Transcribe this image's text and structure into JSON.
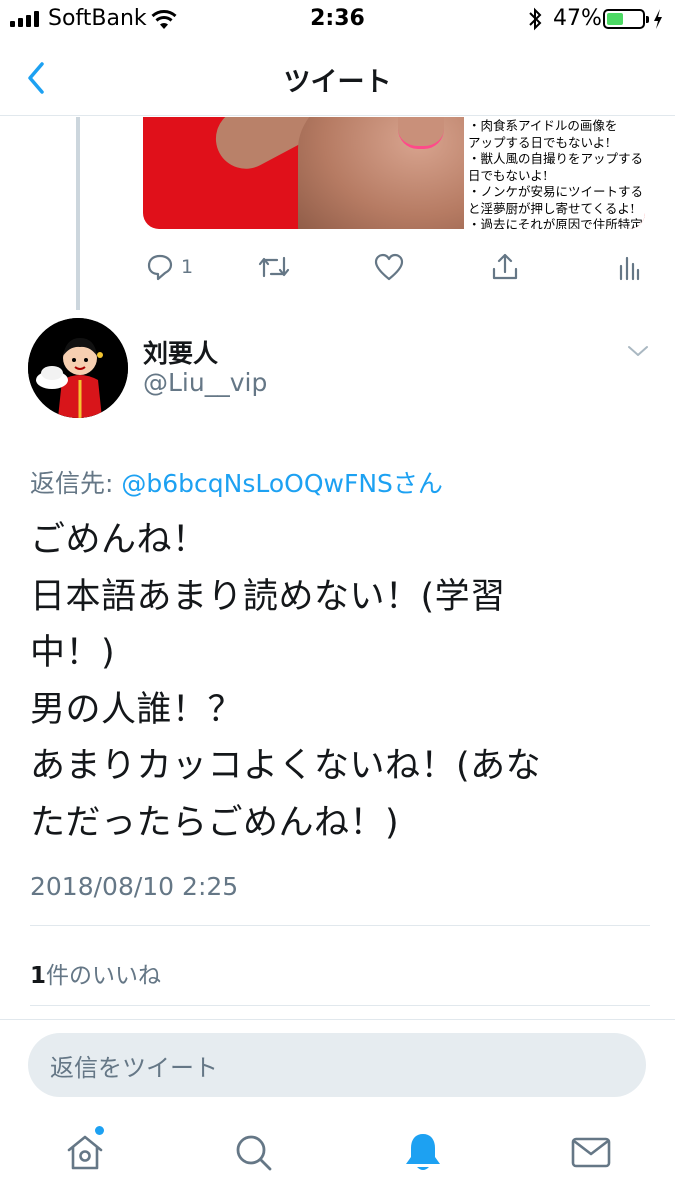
{
  "status_bar": {
    "carrier": "SoftBank",
    "time": "2:36",
    "battery_percent": "47%",
    "battery_level": 0.47,
    "icons": [
      "signal-icon",
      "wifi-icon",
      "bluetooth-icon",
      "battery-icon",
      "charging-icon"
    ]
  },
  "nav": {
    "title": "ツイート",
    "back_icon": "chevron-left-icon"
  },
  "parent_tweet": {
    "media_caption_lines": [
      "・肉食系アイドルの画像を",
      "アップする日でもないよ!",
      "・獣人風の自撮りをアップする",
      "日でもないよ!",
      "・ノンケが安易にツイートする",
      "と淫夢厨が押し寄せてくるよ!",
      "・過去にそれが原因で住所特定"
    ],
    "reply_count": "1",
    "actions": [
      "reply-icon",
      "retweet-icon",
      "like-icon",
      "share-icon",
      "analytics-icon"
    ]
  },
  "tweet": {
    "author_name": "刘要人",
    "author_handle": "@Liu__vip",
    "reply_to_label": "返信先: ",
    "reply_to_handle": "@b6bcqNsLoOQwFNSさん",
    "text_lines": [
      "ごめんね！",
      "日本語あまり読めない！(学習",
      "中！)",
      "男の人誰！？",
      "あまりカッコよくないね！(あな",
      "ただったらごめんね！)"
    ],
    "timestamp": "2018/08/10 2:25",
    "likes_count": "1",
    "likes_label": "件のいいね"
  },
  "reply_box": {
    "placeholder": "返信をツイート"
  },
  "tabbar": {
    "tabs": [
      "home-icon",
      "search-icon",
      "notifications-icon",
      "messages-icon"
    ],
    "active": "notifications-icon",
    "accent_color": "#1da1f2"
  }
}
